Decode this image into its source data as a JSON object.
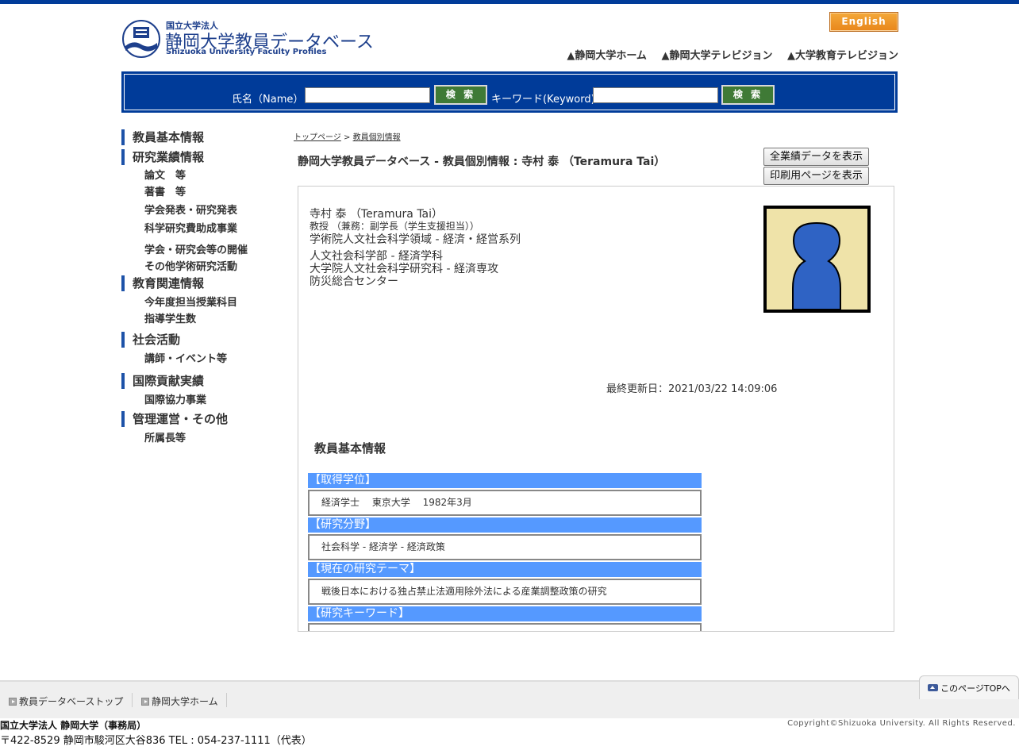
{
  "header": {
    "logo": {
      "org_small": "国立大学法人",
      "title": "静岡大学教員データベース",
      "subtitle_en": "Shizuoka University Faculty Profiles"
    },
    "english_label": "English",
    "top_links": [
      "▲静岡大学ホーム",
      "▲静岡大学テレビジョン",
      "▲大学教育テレビジョン"
    ]
  },
  "search": {
    "name_label": "氏名（Name）",
    "name_value": "",
    "keyword_label": "キーワード(Keyword)",
    "keyword_value": "",
    "button_label": "検 索"
  },
  "sidenav": [
    {
      "label": "教員基本情報",
      "items": []
    },
    {
      "label": "研究業績情報",
      "items": [
        "論文　等",
        "著書　等",
        "学会発表・研究発表",
        "科学研究費助成事業",
        "学会・研究会等の開催",
        "その他学術研究活動"
      ]
    },
    {
      "label": "教育関連情報",
      "items": [
        "今年度担当授業科目",
        "指導学生数"
      ]
    },
    {
      "label": "社会活動",
      "items": [
        "講師・イベント等"
      ]
    },
    {
      "label": "国際貢献実績",
      "items": [
        "国際協力事業"
      ]
    },
    {
      "label": "管理運営・その他",
      "items": [
        "所属長等"
      ]
    }
  ],
  "breadcrumb": {
    "home": "トップページ",
    "sep": ">",
    "current": "教員個別情報"
  },
  "page_title": "静岡大学教員データベース - 教員個別情報 : 寺村 泰 （Teramura Tai）",
  "buttons": {
    "all_data": "全業績データを表示",
    "print": "印刷用ページを表示"
  },
  "profile": {
    "name": "寺村 泰 （Teramura Tai）",
    "position": "教授 （兼務：副学長（学生支援担当））",
    "affiliation_1": "学術院人文社会科学領域 - 経済・経営系列",
    "affiliations": [
      "人文社会科学部 - 経済学科",
      "大学院人文社会科学研究科 - 経済専攻",
      "防災総合センター"
    ],
    "updated": "最終更新日：2021/03/22 14:09:06"
  },
  "basic_info": {
    "title": "教員基本情報",
    "blocks": [
      {
        "head": "【取得学位】",
        "body": "経済学士　 東京大学　  1982年3月"
      },
      {
        "head": "【研究分野】",
        "body": "社会科学 - 経済学 - 経済政策"
      },
      {
        "head": "【現在の研究テーマ】",
        "body": "戦後日本における独占禁止法適用除外法による産業調整政策の研究"
      },
      {
        "head": "【研究キーワード】",
        "body": ""
      }
    ]
  },
  "footer": {
    "links": [
      "教員データベーストップ",
      "静岡大学ホーム"
    ],
    "page_top": "このページTOPへ",
    "org": "国立大学法人 静岡大学（事務局）",
    "address": "〒422-8529 静岡市駿河区大谷836 TEL : 054-237-1111（代表）",
    "copyright": "Copyright©Shizuoka University. All Rights Reserved."
  },
  "colors": {
    "brand_blue": "#003b99",
    "block_head": "#5599ff",
    "search_button": "#3f7a36",
    "english_button": "#e8861b"
  }
}
